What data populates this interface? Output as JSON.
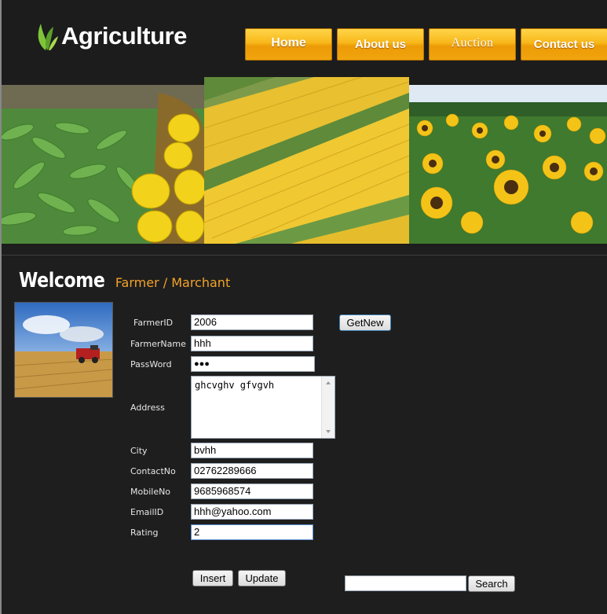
{
  "logo": {
    "text": "Agriculture",
    "icon": "leaf-icon"
  },
  "nav": [
    {
      "label": "Home"
    },
    {
      "label": "About us"
    },
    {
      "label": "Auction"
    },
    {
      "label": "Contact us"
    }
  ],
  "welcome": {
    "big": "Welcome",
    "sub": "Farmer / Marchant"
  },
  "form": {
    "farmer_id_label": "FarmerID",
    "farmer_id_value": "2006",
    "farmer_name_label": "FarmerName",
    "farmer_name_value": "hhh",
    "password_label": "PassWord",
    "password_value": "●●●",
    "address_label": "Address",
    "address_value": "ghcvghv gfvgvh",
    "city_label": "City",
    "city_value": "bvhh",
    "contact_label": "ContactNo",
    "contact_value": "02762289666",
    "mobile_label": "MobileNo",
    "mobile_value": "9685968574",
    "email_label": "EmailID",
    "email_value": "hhh@yahoo.com",
    "rating_label": "Rating",
    "rating_value": "2"
  },
  "buttons": {
    "getnew": "GetNew",
    "insert": "Insert",
    "update": "Update",
    "search": "Search"
  },
  "search": {
    "value": ""
  },
  "colors": {
    "accent": "#f3a32a",
    "nav_orange": "#f7b719",
    "background": "#1e1e1e"
  }
}
